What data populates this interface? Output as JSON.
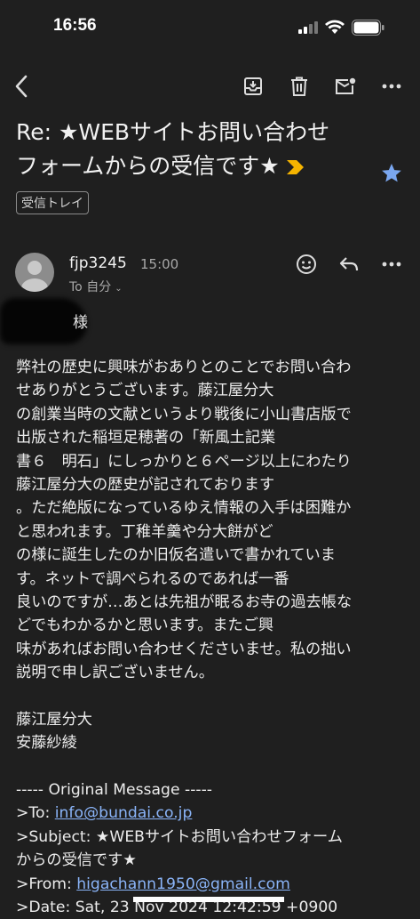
{
  "status_bar": {
    "time": "16:56"
  },
  "subject": {
    "line1": "Re: ★WEBサイトお問い合わせ",
    "line2": "フォームからの受信です★"
  },
  "label": "受信トレイ",
  "sender": {
    "name": "fjp3245",
    "time": "15:00",
    "recipient": "To 自分"
  },
  "greeting": "様",
  "body_lines": [
    "弊社の歴史に興味がおありとのことでお問い合わ",
    "せありがとうございます。藤江屋分大",
    "の創業当時の文献というより戦後に小山書店版で",
    "出版された稲垣足穂著の「新風土記業",
    "書６　明石」にしっかりと６ページ以上にわたり",
    "藤江屋分大の歴史が記されております",
    "。ただ絶版になっているゆえ情報の入手は困難か",
    "と思われます。丁稚羊羹や分大餅がど",
    "の様に誕生したのか旧仮名遣いで書かれていま",
    "す。ネットで調べられるのであれば一番",
    "良いのですが…あとは先祖が眠るお寺の過去帳な",
    "どでもわかるかと思います。またご興",
    "味があればお問い合わせくださいませ。私の拙い",
    "説明で申し訳ございません。",
    "",
    "藤江屋分大",
    "安藤紗綾",
    "",
    "----- Original Message -----"
  ],
  "original": {
    "to_prefix": ">To: ",
    "to_email": "info@bundai.co.jp",
    "subject_prefix": ">Subject: ",
    "subject_text_1": "★WEBサイトお問い合わせフォーム",
    "subject_text_2": "からの受信です★",
    "from_prefix": ">From: ",
    "from_email": "higachann1950@gmail.com",
    "date_line": ">Date: Sat, 23 Nov 2024 12:42:59 +0900"
  },
  "colors": {
    "background": "#1f1f1f",
    "link": "#8ab4f8",
    "star": "#7aa7f0",
    "important_marker": "#f5b400"
  },
  "icons": [
    "back-icon",
    "archive-icon",
    "delete-icon",
    "mark-unread-icon",
    "more-icon",
    "star-icon",
    "emoji-react-icon",
    "reply-icon",
    "more-icon"
  ]
}
